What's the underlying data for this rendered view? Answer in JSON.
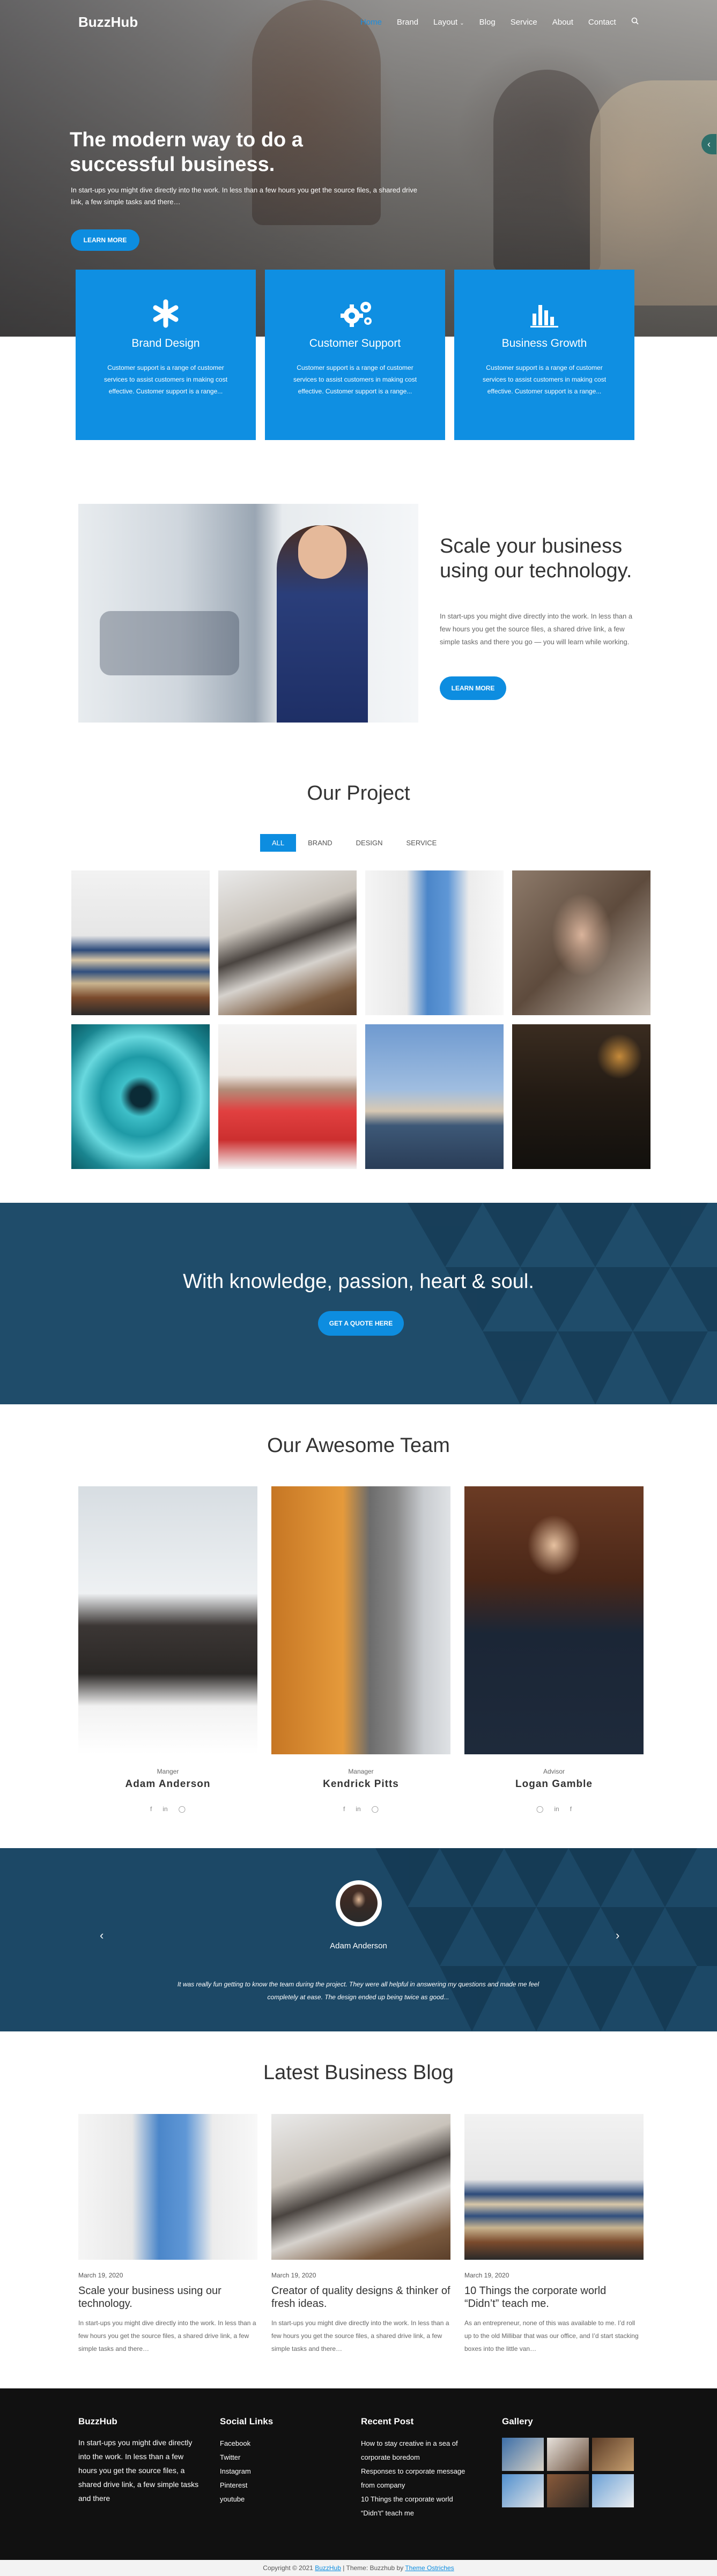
{
  "header": {
    "logo": "BuzzHub",
    "nav": [
      "Home",
      "Brand",
      "Layout",
      "Blog",
      "Service",
      "About",
      "Contact"
    ],
    "active_nav": "Home",
    "search_icon": "search-icon"
  },
  "hero": {
    "title": "The modern way to do a successful business.",
    "text": "In start-ups you might dive directly into the work. In less than a few hours you get the source files, a shared drive link, a few simple tasks and there…",
    "button": "LEARN MORE"
  },
  "features": [
    {
      "title": "Brand Design",
      "icon": "asterisk-icon",
      "text": "Customer support is a range of customer services to assist customers in making cost effective. Customer support is a range..."
    },
    {
      "title": "Customer Support",
      "icon": "gears-icon",
      "text": "Customer support is a range of customer services to assist customers in making cost effective. Customer support is a range..."
    },
    {
      "title": "Business Growth",
      "icon": "bar-chart-icon",
      "text": "Customer support is a range of customer services to assist customers in making cost effective. Customer support is a range..."
    }
  ],
  "about": {
    "title": "Scale your business using our technology.",
    "text": "In start-ups you might dive directly into the work. In less than a few hours you get the source files, a shared drive link, a few simple tasks and there you go — you will learn while working.",
    "button": "LEARN MORE"
  },
  "projects": {
    "title": "Our Project",
    "filters": [
      "ALL",
      "BRAND",
      "DESIGN",
      "SERVICE"
    ],
    "active_filter": "ALL"
  },
  "banner": {
    "title": "With knowledge, passion, heart & soul.",
    "button": "GET A QUOTE HERE"
  },
  "team": {
    "title": "Our Awesome Team",
    "members": [
      {
        "role": "Manger",
        "name": "Adam Anderson",
        "socials": [
          "f",
          "in",
          "ig"
        ]
      },
      {
        "role": "Manager",
        "name": "Kendrick Pitts",
        "socials": [
          "f",
          "in",
          "ig"
        ]
      },
      {
        "role": "Advisor",
        "name": "Logan Gamble",
        "socials": [
          "ig",
          "in",
          "f"
        ]
      }
    ]
  },
  "testimonial": {
    "name": "Adam Anderson",
    "quote": "It was really fun getting to know the team during the project. They were all helpful in answering my questions and made me feel completely at ease. The design ended up being twice as good..."
  },
  "blog": {
    "title": "Latest Business Blog",
    "posts": [
      {
        "date": "March 19, 2020",
        "title": "Scale your business using our technology.",
        "text": "In start-ups you might dive directly into the work. In less than a few hours you get the source files, a shared drive link, a few simple tasks and there…"
      },
      {
        "date": "March 19, 2020",
        "title": "Creator of quality designs & thinker of fresh ideas.",
        "text": "In start-ups you might dive directly into the work. In less than a few hours you get the source files, a shared drive link, a few simple tasks and there…"
      },
      {
        "date": "March 19, 2020",
        "title": "10 Things the corporate world “Didn’t” teach me.",
        "text": "As an entrepreneur, none of this was available to me. I’d roll up to the old Millibar that was our office, and I’d start stacking boxes into the little van…"
      }
    ]
  },
  "footer": {
    "about_title": "BuzzHub",
    "about_text": "In start-ups you might dive directly into the work. In less than a few hours you get the source files, a shared drive link, a few simple tasks and there",
    "social_title": "Social Links",
    "social_links": [
      "Facebook",
      "Twitter",
      "Instagram",
      "Pinterest",
      "youtube"
    ],
    "recent_title": "Recent Post",
    "recent_posts": [
      "How to stay creative in a sea of corporate boredom",
      "Responses to corporate message from company",
      "10 Things the corporate world “Didn’t” teach me"
    ],
    "gallery_title": "Gallery"
  },
  "copyright": {
    "prefix": "Copyright © 2021",
    "link1": "BuzzHub",
    "middle": "| Theme: Buzzhub by",
    "link2": "Theme Ostriches"
  }
}
